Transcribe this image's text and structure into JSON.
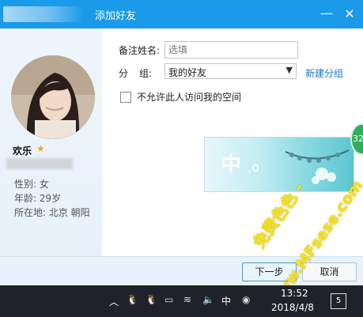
{
  "window": {
    "title": "添加好友",
    "minimize_icon": "minimize-icon",
    "close_icon": "close-icon"
  },
  "profile": {
    "nickname": "欢乐",
    "gender": "性别: 女",
    "age": "年龄: 29岁",
    "location": "所在地: 北京  朝阳"
  },
  "form": {
    "remark_label": "备注姓名:",
    "remark_placeholder": "选填",
    "group_label_1": "分",
    "group_label_2": "组:",
    "group_value": "我的好友",
    "new_group_link": "新建分组",
    "privacy_label": "不允许此人访问我的空间"
  },
  "banner": {
    "text": "中",
    "dot": ",o"
  },
  "badge": {
    "text": "32"
  },
  "footer": {
    "next_label": "下一步",
    "cancel_label": "取消"
  },
  "watermark": {
    "line1": "免费色色 -",
    "line2": "www.MFsese.com"
  },
  "taskbar": {
    "ime": "中",
    "time": "13:52",
    "date": "2018/4/8",
    "notifications": "5"
  },
  "colors": {
    "titlebar": "#1a9ae8",
    "link": "#1a79c9",
    "watermark": "#f4e21a",
    "badge": "#2fae5b"
  }
}
